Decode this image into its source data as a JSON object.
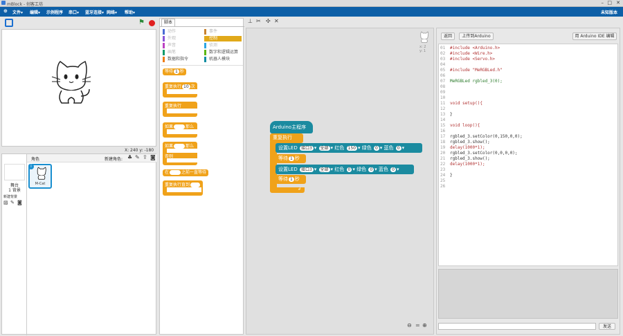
{
  "window": {
    "title": "mBlock - 创客工坊"
  },
  "menu": {
    "items": [
      "文件",
      "编辑",
      "示例程序",
      "串口",
      "蓝牙连接",
      "网络",
      "帮助"
    ],
    "status": "未知版本"
  },
  "stage": {
    "coords": {
      "x_label": "X: 240",
      "y_label": "y: -180"
    }
  },
  "sprites": {
    "header": "角色",
    "new_sprite": "新建角色:",
    "stage_label": "舞台",
    "stage_backdrops": "1 背景",
    "new_backdrop": "新建背景",
    "sprite_name": "M-Cat",
    "sprite_badge": "i"
  },
  "tabs": {
    "scripts": "脚本"
  },
  "categories": [
    {
      "label": "动作",
      "active": false,
      "color": "#4a6cd4"
    },
    {
      "label": "事件",
      "active": false,
      "color": "#c88330"
    },
    {
      "label": "外观",
      "active": false,
      "color": "#8a55d7"
    },
    {
      "label": "控制",
      "active": true,
      "color": "#e1a91a"
    },
    {
      "label": "声音",
      "active": false,
      "color": "#bb42c3"
    },
    {
      "label": "侦测",
      "active": false,
      "color": "#2ca5e2"
    },
    {
      "label": "画笔",
      "active": false,
      "color": "#0e9a6c"
    },
    {
      "label": "数字和逻辑运算",
      "active": false,
      "color": "#5cb712"
    },
    {
      "label": "数据和指令",
      "active": false,
      "color": "#ee7d16"
    },
    {
      "label": "机器人模块",
      "active": false,
      "color": "#0d8da2"
    }
  ],
  "palette": {
    "wait": "等待",
    "wait_val": "1",
    "sec": "秒",
    "repeat": "重复执行",
    "repeat_val": "10",
    "times": "次",
    "forever": "重复执行",
    "if": "如果",
    "then": "那么",
    "if2": "如果",
    "then2": "那么",
    "else": "否则",
    "wait_until": "在",
    "wait_until2": "之前一直等待",
    "repeat_until": "重复执行直到"
  },
  "workspace": {
    "hat": "Arduino主程序",
    "forever": "重复执行",
    "led1": {
      "set": "设置LED",
      "port": "接口3",
      "all": "全部",
      "red": "红色",
      "red_val": "150",
      "green": "绿色",
      "green_val": "0",
      "blue": "蓝色",
      "blue_val": "0"
    },
    "wait1": {
      "label": "等待",
      "val": "1",
      "unit": "秒"
    },
    "led2": {
      "set": "设置LED",
      "port": "接口3",
      "all": "全部",
      "red": "红色",
      "red_val": "0",
      "green": "绿色",
      "green_val": "0",
      "blue": "蓝色",
      "blue_val": "0"
    },
    "wait2": {
      "label": "等待",
      "val": "1",
      "unit": "秒"
    },
    "sprite_xy_x": "x: 2",
    "sprite_xy_y": "y: 1",
    "zoom_eq": "="
  },
  "code": {
    "back": "返回",
    "upload": "上传到Arduino",
    "open_ide": "用 Arduino IDE 编辑",
    "send": "发送",
    "lines": [
      "#include <Arduino.h>",
      "#include <Wire.h>",
      "#include <Servo.h>",
      "",
      "#include \"MeRGBLed.h\"",
      "",
      "MeRGBLed rgbled_3(0);",
      "",
      "",
      "",
      "void setup(){",
      "",
      "}",
      "",
      "void loop(){",
      "",
      "    rgbled_3.setColor(0,150,0,0);",
      "    rgbled_3.show();",
      "    delay(1000*1);",
      "    rgbled_3.setColor(0,0,0,0);",
      "    rgbled_3.show();",
      "    delay(1000*1);",
      "",
      "}",
      "",
      ""
    ]
  },
  "colors": {
    "menu_bg": "#0d5fa7",
    "control": "#f0a21a",
    "robot": "#1b8ba0",
    "go": "#2a8a3a",
    "stop": "#e02020"
  }
}
